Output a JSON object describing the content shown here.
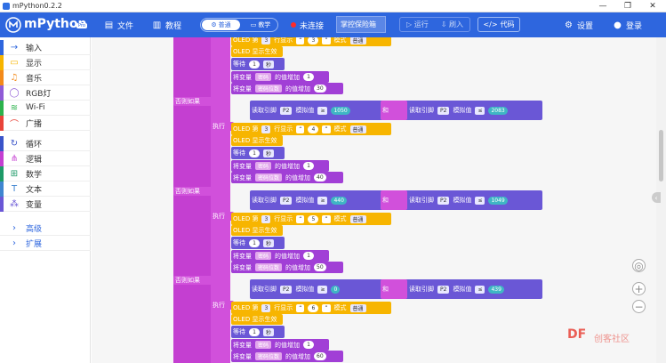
{
  "window": {
    "title": "mPython0.2.2",
    "minimize": "—",
    "maximize": "❐",
    "close": "✕"
  },
  "toolbar": {
    "brand": "mPython",
    "version_badge": "Pro",
    "file": "文件",
    "tutorial": "教程",
    "mode_normal": "普通",
    "mode_tutor": "教学",
    "connection": "未连接",
    "device": "掌控保险箱",
    "run": "运行",
    "flash": "刷入",
    "code": "代码",
    "settings": "设置",
    "login": "登录"
  },
  "sidebar": {
    "items": [
      {
        "label": "输入",
        "color": "#2e66de",
        "icon": "→"
      },
      {
        "label": "显示",
        "color": "#f7b500",
        "icon": "▭"
      },
      {
        "label": "音乐",
        "color": "#f38a1a",
        "icon": "♫"
      },
      {
        "label": "RGB灯",
        "color": "#8f5bd6",
        "icon": "◯"
      },
      {
        "label": "Wi-Fi",
        "color": "#2bb24c",
        "icon": "≋"
      },
      {
        "label": "广播",
        "color": "#e8443a",
        "icon": "⌒"
      },
      {
        "label": "循环",
        "color": "#3a54c9",
        "icon": "↻"
      },
      {
        "label": "逻辑",
        "color": "#c43fd1",
        "icon": "⋔"
      },
      {
        "label": "数学",
        "color": "#1e9a68",
        "icon": "⊞"
      },
      {
        "label": "文本",
        "color": "#3f85d0",
        "icon": "T"
      },
      {
        "label": "变量",
        "color": "#6a57d6",
        "icon": "⁂"
      },
      {
        "label": "高级",
        "color": "#2e66de",
        "icon": "›"
      },
      {
        "label": "扩展",
        "color": "#2e66de",
        "icon": "›"
      }
    ]
  },
  "blocks": {
    "oled_line": "OLED 第",
    "line_show": "行显示",
    "mode": "模式",
    "normal": "普通",
    "oled_refresh": "OLED 显示生效",
    "wait": "等待",
    "sec": "秒",
    "set_var": "将变量",
    "inc_by": "的值增加",
    "var_pwd": "密码",
    "var_pwd_digits": "密码位数",
    "else_if": "否则如果",
    "do": "执行",
    "read_pin": "读取引脚",
    "analog": "模拟值",
    "and": "和",
    "pin_p2": "P2",
    "quote_open": "“",
    "quote_close": "”",
    "gte": "≥",
    "lte": "≤",
    "row3": "3",
    "one": "1",
    "rows": [
      {
        "text": "3",
        "digits": "30"
      },
      {
        "low": "1050",
        "high": "2083",
        "text": "4",
        "digits": "40"
      },
      {
        "low": "440",
        "high": "1049",
        "text": "5",
        "digits": "50"
      },
      {
        "low": "0",
        "high": "439",
        "text": "6",
        "digits": "60"
      }
    ]
  },
  "watermark": {
    "text": "DF",
    "sub": "创客社区"
  }
}
